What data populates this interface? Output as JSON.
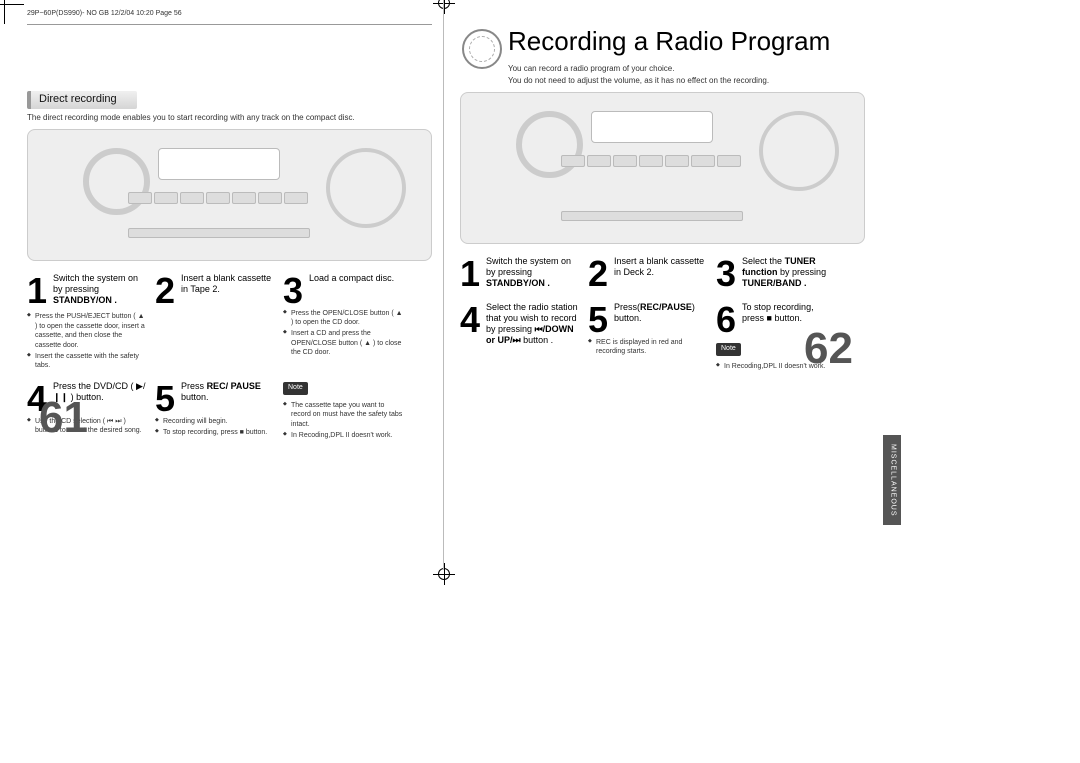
{
  "header_line": "29P~60P(DS990)- NO GB  12/2/04 10:20  Page 56",
  "left": {
    "section_title": "Direct recording",
    "intro": "The direct recording mode enables you to start recording with any track on the compact disc.",
    "steps": {
      "s1": {
        "num": "1",
        "text": "Switch the system on by pressing",
        "accent": "STANDBY/ON .",
        "sub": [
          "Press the PUSH/EJECT button ( ▲ ) to open the cassette door, insert a cassette, and then close the cassette door.",
          "Insert the cassette with the safety tabs."
        ]
      },
      "s2": {
        "num": "2",
        "text": "Insert a blank cassette in Tape 2."
      },
      "s3": {
        "num": "3",
        "text": "Load a compact disc.",
        "sub": [
          "Press the OPEN/CLOSE button ( ▲ ) to open the CD door.",
          "Insert a CD and press the OPEN/CLOSE button ( ▲ ) to close the CD door."
        ]
      },
      "s4": {
        "num": "4",
        "text": "Press the DVD/CD ( ▶/❙❙ ) button.",
        "sub": [
          "Use the CD selection ( ⏮ ⏭ ) buttons to select the desired song."
        ]
      },
      "s5": {
        "num": "5",
        "text": "Press",
        "accent": "REC/ PAUSE",
        "text2": "button.",
        "sub": [
          "Recording will begin.",
          "To stop recording, press ■ button."
        ]
      },
      "note_label": "Note ",
      "note": [
        "The cassette tape you want to record on must have the safety tabs intact.",
        "In Recoding,DPL II doesn't work."
      ]
    },
    "page_number": "61"
  },
  "right": {
    "title": "Recording a Radio Program",
    "intro1": "You can record a radio program of your choice.",
    "intro2": "You do not need to adjust the volume, as it has no effect on the recording.",
    "steps": {
      "s1": {
        "num": "1",
        "text": "Switch the system on by pressing",
        "accent": "STANDBY/ON ."
      },
      "s2": {
        "num": "2",
        "text": "Insert a blank cassette in Deck 2."
      },
      "s3": {
        "num": "3",
        "text": "Select the",
        "accent": "TUNER function",
        "text2": "by pressing",
        "accent2": "TUNER/BAND ."
      },
      "s4": {
        "num": "4",
        "text": "Select the radio station that you wish to record by pressing",
        "accent": "⏮/DOWN or UP/⏭",
        "text2": "button ."
      },
      "s5": {
        "num": "5",
        "text": "Press",
        "accent": "REC/PAUSE",
        "text2": "button.",
        "sub": [
          "REC is displayed in red and recording starts."
        ]
      },
      "s6": {
        "num": "6",
        "text": "To stop recording, press ■ button."
      },
      "note_label": "Note ",
      "note": [
        "In Recoding,DPL II doesn't work."
      ]
    },
    "side_tab": "MISCELLANEOUS",
    "page_number": "62"
  }
}
